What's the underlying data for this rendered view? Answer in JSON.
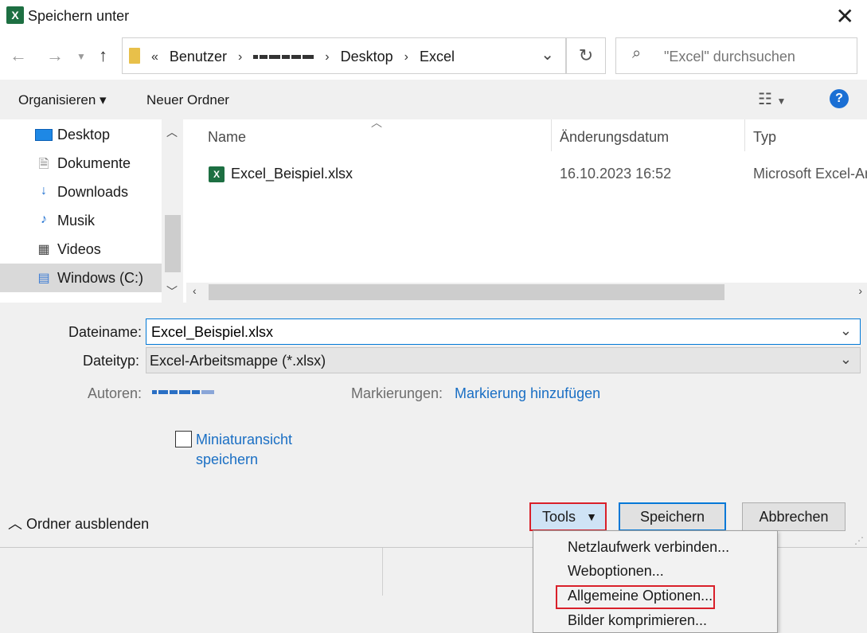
{
  "window": {
    "title": "Speichern unter",
    "app_icon": "X",
    "close": "✕"
  },
  "nav": {
    "breadcrumb_prefix": "«",
    "breadcrumbs": [
      "Benutzer",
      "Desktop",
      "Excel"
    ],
    "search_placeholder": "\"Excel\" durchsuchen"
  },
  "toolbar": {
    "organize": "Organisieren ▾",
    "new_folder": "Neuer Ordner"
  },
  "sidebar": {
    "items": [
      {
        "label": "Desktop",
        "icon": "desktop-icon"
      },
      {
        "label": "Dokumente",
        "icon": "documents-icon"
      },
      {
        "label": "Downloads",
        "icon": "downloads-icon"
      },
      {
        "label": "Musik",
        "icon": "music-icon"
      },
      {
        "label": "Videos",
        "icon": "videos-icon"
      },
      {
        "label": "Windows (C:)",
        "icon": "drive-icon"
      }
    ]
  },
  "files": {
    "columns": [
      "Name",
      "Änderungsdatum",
      "Typ"
    ],
    "rows": [
      {
        "name": "Excel_Beispiel.xlsx",
        "date": "16.10.2023 16:52",
        "type": "Microsoft Excel-Ar"
      }
    ]
  },
  "form": {
    "filename_label": "Dateiname:",
    "filename_value": "Excel_Beispiel.xlsx",
    "filetype_label": "Dateityp:",
    "filetype_value": "Excel-Arbeitsmappe (*.xlsx)",
    "authors_label": "Autoren:",
    "tags_label": "Markierungen:",
    "tags_link": "Markierung hinzufügen",
    "thumbnail_line1": "Miniaturansicht",
    "thumbnail_line2": "speichern"
  },
  "footer": {
    "hide_folders": "Ordner ausblenden",
    "tools": "Tools",
    "save": "Speichern",
    "cancel": "Abbrechen"
  },
  "tools_menu": {
    "items": [
      "Netzlaufwerk verbinden...",
      "Weboptionen...",
      "Allgemeine Optionen...",
      "Bilder komprimieren..."
    ]
  }
}
